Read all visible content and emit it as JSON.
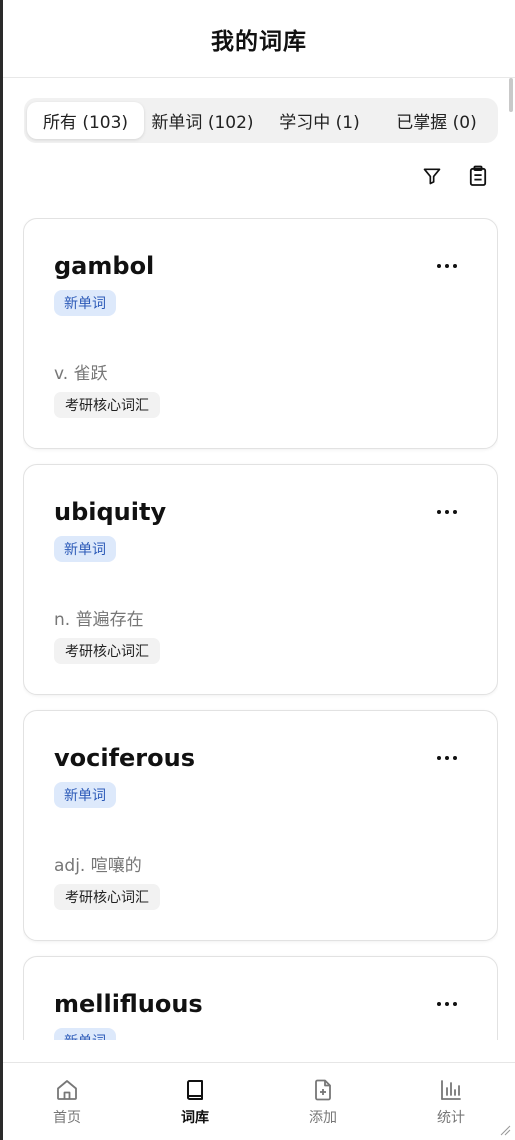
{
  "header": {
    "title": "我的词库"
  },
  "tabs": [
    {
      "label": "所有 (103)",
      "active": true
    },
    {
      "label": "新单词 (102)",
      "active": false
    },
    {
      "label": "学习中 (1)",
      "active": false
    },
    {
      "label": "已掌握 (0)",
      "active": false
    }
  ],
  "toolbar": {
    "filter_icon": "filter-icon",
    "clipboard_icon": "clipboard-icon"
  },
  "words": [
    {
      "word": "gambol",
      "status": "新单词",
      "meaning": "v. 雀跃",
      "tag": "考研核心词汇"
    },
    {
      "word": "ubiquity",
      "status": "新单词",
      "meaning": "n. 普遍存在",
      "tag": "考研核心词汇"
    },
    {
      "word": "vociferous",
      "status": "新单词",
      "meaning": "adj. 喧嚷的",
      "tag": "考研核心词汇"
    },
    {
      "word": "mellifluous",
      "status": "新单词",
      "meaning": "",
      "tag": ""
    }
  ],
  "nav": [
    {
      "label": "首页",
      "icon": "home-icon",
      "active": false
    },
    {
      "label": "词库",
      "icon": "book-icon",
      "active": true
    },
    {
      "label": "添加",
      "icon": "file-plus-icon",
      "active": false
    },
    {
      "label": "统计",
      "icon": "bar-chart-icon",
      "active": false
    }
  ],
  "colors": {
    "status_bg": "#dde9fb",
    "status_text": "#2d5bb8",
    "tag_bg": "#f2f2f2"
  }
}
